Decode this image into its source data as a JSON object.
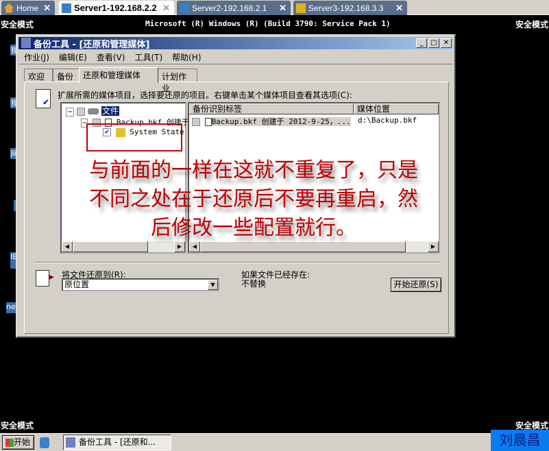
{
  "remote_tabs": [
    {
      "label": "Home",
      "icon": "home-icon"
    },
    {
      "label": "Server1-192.168.2.2",
      "icon": "server-icon",
      "active": true
    },
    {
      "label": "Server2-192.168.2.1",
      "icon": "server-icon"
    },
    {
      "label": "Server3-192.168.3.3",
      "icon": "server-warning-icon"
    }
  ],
  "desktop": {
    "safe_mode": "安全模式",
    "banner": "Microsoft (R) Windows (R) (Build 3790: Service Pack 1)",
    "icons": [
      "我",
      "我",
      "网",
      "",
      "IE",
      "ne"
    ]
  },
  "window": {
    "title": "备份工具 - [还原和管理媒体]",
    "menu": [
      "作业(J)",
      "编辑(E)",
      "查看(V)",
      "工具(T)",
      "帮助(H)"
    ],
    "tabs": [
      "欢迎",
      "备份",
      "还原和管理媒体",
      "计划作业"
    ],
    "instruction": "扩展所需的媒体项目，选择要还原的项目。右键单击某个媒体项目查看其选项(C):",
    "tree": {
      "root": "文件",
      "child": "Backup.bkf 创建于",
      "leaf": "System State"
    },
    "list": {
      "columns": [
        "备份识别标签",
        "媒体位置"
      ],
      "rows": [
        [
          "Backup.bkf 创建于 2012-9-25，...",
          "d:\\Backup.bkf"
        ]
      ]
    },
    "restore_to_label": "将文件还原到(R):",
    "restore_to_value": "原位置",
    "if_exists_label": "如果文件已经存在:",
    "if_exists_value": "不替换",
    "start_button": "开始还原(S)"
  },
  "annotation": {
    "lines": [
      "与前面的一样在这就不重复了，只是",
      "不同之处在于还原后不要再重启，然",
      "后修改一些配置就行。"
    ],
    "color": "#c00000"
  },
  "taskbar": {
    "start": "开始",
    "task": "备份工具 - [还原和..."
  },
  "watermark": "刘晨昌"
}
